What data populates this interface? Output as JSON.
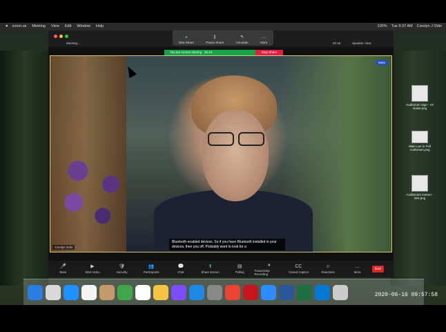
{
  "menubar": {
    "app": "zoom.us",
    "items": [
      "Meeting",
      "View",
      "Edit",
      "Window",
      "Help"
    ],
    "status": [
      "100%",
      "Tue 9:37 AM",
      "Carolyn J Odio"
    ]
  },
  "window": {
    "tab_meeting": "Meeting...",
    "tab_view": "Speaker View",
    "pill": "00:18"
  },
  "share_toolbar": [
    {
      "label": "New Share",
      "icon": "▲"
    },
    {
      "label": "Pause Share",
      "icon": "∥"
    },
    {
      "label": "Annotate",
      "icon": "✎"
    },
    {
      "label": "More",
      "icon": "…"
    }
  ],
  "share_status": {
    "sharing": "You are screen sharing",
    "timer": "25:14",
    "stop": "Stop Share"
  },
  "video": {
    "participant": "Carolyn Odio",
    "badge": "Mute",
    "caption": "Bluetooth enabled devices. So if you have Bluetooth installed in your devices, then you off. Probably want to look for a"
  },
  "controls": [
    {
      "label": "Mute",
      "icon": "🎤"
    },
    {
      "label": "Start Video",
      "icon": "▶"
    },
    {
      "label": "Security",
      "icon": "🛡"
    },
    {
      "label": "Participants",
      "icon": "👥"
    },
    {
      "label": "Chat",
      "icon": "💬"
    },
    {
      "label": "Share Screen",
      "icon": "⬆"
    },
    {
      "label": "Polling",
      "icon": "▤"
    },
    {
      "label": "Pause/Stop Recording",
      "icon": "⏸"
    },
    {
      "label": "Closed Caption",
      "icon": "CC"
    },
    {
      "label": "Reactions",
      "icon": "☺"
    },
    {
      "label": "More",
      "icon": "…"
    }
  ],
  "end_label": "End",
  "desktop": [
    {
      "label": "Audtorium Sign - rel sioasi.png"
    },
    {
      "label": "Main Lee in Fell Audtorium.png"
    },
    {
      "label": "Auditorium Instem - stre.png"
    }
  ],
  "dock_colors": [
    "#2a7de1",
    "#d9d9d9",
    "#1e90ff",
    "#f4f4f4",
    "#c49a6c",
    "#3fa64a",
    "#ffffff",
    "#f5c542",
    "#7c4dff",
    "#1e88e5",
    "#888888",
    "#ea4335",
    "#c4161c",
    "#2d8cff",
    "#2b579a",
    "#1d6f42",
    "#0078d4",
    "#cccccc"
  ],
  "timestamp": "2020-06-16 09:57:58"
}
